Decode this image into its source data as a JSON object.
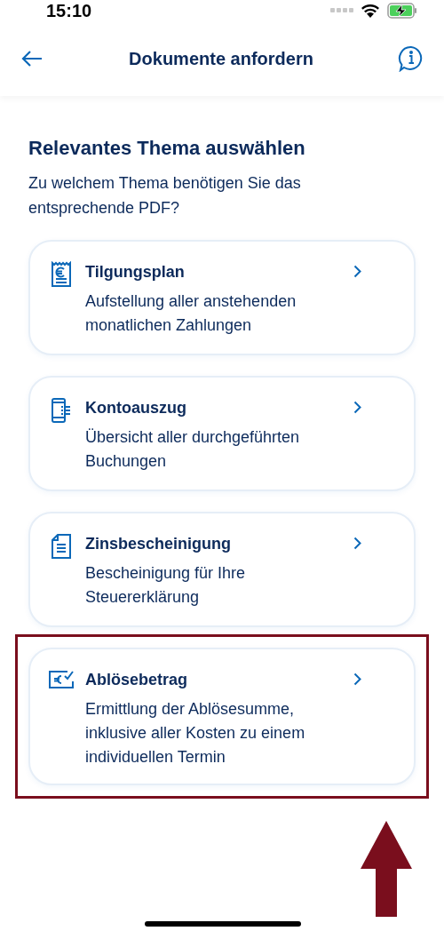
{
  "status_bar": {
    "time": "15:10",
    "battery_charging": true
  },
  "header": {
    "title": "Dokumente anfordern"
  },
  "heading": "Relevantes Thema auswählen",
  "subtitle": "Zu welchem Thema benötigen Sie das entsprechende PDF?",
  "items": [
    {
      "kind": "receipt",
      "title": "Tilgungsplan",
      "description": "Aufstellung aller anstehenden monatlichen Zahlungen",
      "highlighted": false
    },
    {
      "kind": "phone",
      "title": "Kontoauszug",
      "description": "Übersicht aller durchgeführten Buchungen",
      "highlighted": false
    },
    {
      "kind": "document",
      "title": "Zinsbescheinigung",
      "description": "Bescheinigung für Ihre Steuererklärung",
      "highlighted": false
    },
    {
      "kind": "money",
      "title": "Ablösebetrag",
      "description": "Ermittlung der Ablösesumme, inklusive aller Kosten zu einem individuellen Termin",
      "highlighted": true
    }
  ],
  "annotation_arrow": true
}
